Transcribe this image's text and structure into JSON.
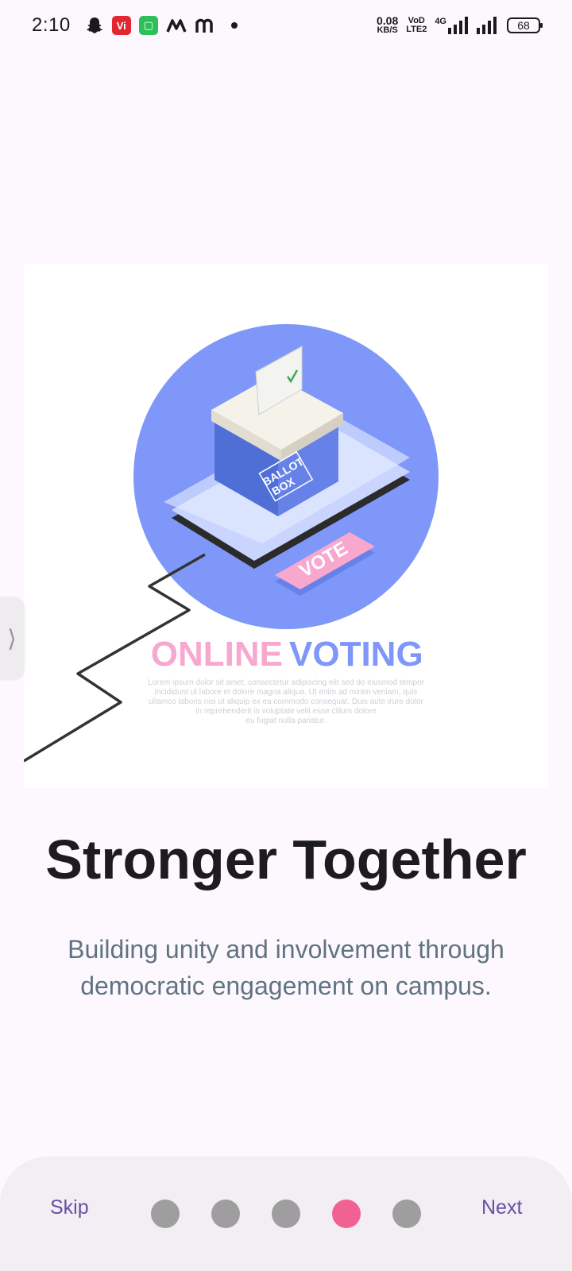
{
  "status_bar": {
    "time": "2:10",
    "net_speed_value": "0.08",
    "net_speed_unit": "KB/S",
    "volte_top": "VoD",
    "volte_bottom": "LTE2",
    "network_type": "4G",
    "battery": "68"
  },
  "illustration": {
    "ballot_box_label_line1": "BALLOT",
    "ballot_box_label_line2": "BOX",
    "vote_button_label": "VOTE",
    "heading_part1": "ONLINE",
    "heading_part2": "VOTING",
    "body_line1": "Lorem ipsum dolor sit amet, consectetur adipiscing elit sed do eiusmod tempor",
    "body_line2": "incididunt ut labore et dolore magna aliqua. Ut enim ad minim veniam, quis",
    "body_line3": "ullamco laboris nisi ut aliquip ex ea commodo consequat. Duis aute irure dolor",
    "body_line4": "in reprehenderit in voluptate velit esse cillum dolore",
    "body_line5": "eu fugiat nulla pariatur.",
    "colors": {
      "circle": "#7f97f9",
      "box": "#4f6fd6",
      "pink": "#f8a8cf",
      "blue_text": "#7f97f9"
    }
  },
  "onboarding": {
    "title": "Stronger Together",
    "subtitle": "Building unity and involvement through democratic engagement on campus."
  },
  "navigation": {
    "skip_label": "Skip",
    "next_label": "Next",
    "page_count": 5,
    "active_index": 3,
    "active_color": "#f06292",
    "inactive_color": "#9e9e9e"
  }
}
